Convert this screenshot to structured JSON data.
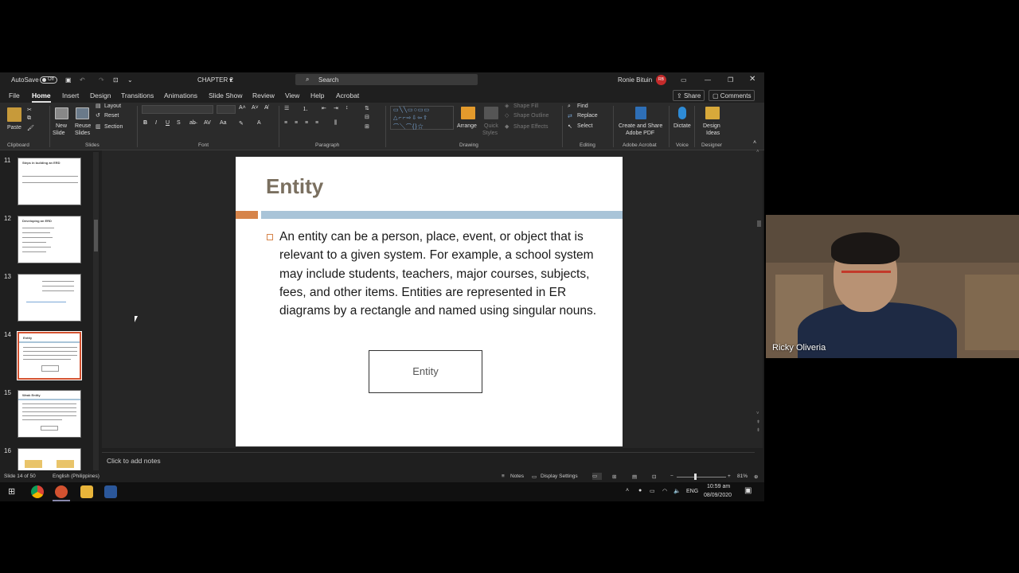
{
  "titlebar": {
    "autosave_label": "AutoSave",
    "autosave_state": "Off",
    "doc_title": "CHAPTER 2",
    "search_placeholder": "Search",
    "user_name": "Ronie Bituin",
    "user_initials": "RB"
  },
  "menu": {
    "tabs": [
      "File",
      "Home",
      "Insert",
      "Design",
      "Transitions",
      "Animations",
      "Slide Show",
      "Review",
      "View",
      "Help",
      "Acrobat"
    ],
    "share_label": "Share",
    "comments_label": "Comments"
  },
  "ribbon": {
    "clipboard": {
      "paste": "Paste",
      "group": "Clipboard"
    },
    "slides": {
      "new_slide_1": "New",
      "new_slide_2": "Slide",
      "reuse_1": "Reuse",
      "reuse_2": "Slides",
      "layout": "Layout",
      "reset": "Reset",
      "section": "Section",
      "group": "Slides"
    },
    "font": {
      "bold": "B",
      "italic": "I",
      "underline": "U",
      "strike": "S",
      "group": "Font"
    },
    "paragraph": {
      "group": "Paragraph"
    },
    "drawing": {
      "arrange": "Arrange",
      "quick_1": "Quick",
      "quick_2": "Styles",
      "shape_fill": "Shape Fill",
      "shape_outline": "Shape Outline",
      "shape_effects": "Shape Effects",
      "group": "Drawing"
    },
    "editing": {
      "find": "Find",
      "replace": "Replace",
      "select": "Select",
      "group": "Editing"
    },
    "acrobat": {
      "line1": "Create and Share",
      "line2": "Adobe PDF",
      "group": "Adobe Acrobat"
    },
    "voice": {
      "dictate": "Dictate",
      "group": "Voice"
    },
    "designer": {
      "line1": "Design",
      "line2": "Ideas",
      "group": "Designer"
    }
  },
  "thumbnails": [
    {
      "number": "11",
      "title": "Steps in building an ERD"
    },
    {
      "number": "12",
      "title": "Developing an ERD"
    },
    {
      "number": "13",
      "title": ""
    },
    {
      "number": "14",
      "title": "Entity"
    },
    {
      "number": "15",
      "title": "Weak Entity"
    },
    {
      "number": "16",
      "title": ""
    }
  ],
  "slide": {
    "title": "Entity",
    "body": "An entity can be a person, place, event, or object that is relevant to a given system. For example, a school system may include students, teachers, major courses, subjects, fees, and other items. Entities are represented in ER diagrams by a rectangle and named using singular nouns.",
    "shape_label": "Entity"
  },
  "notes_placeholder": "Click to add notes",
  "status": {
    "slide_counter": "Slide 14 of 50",
    "language": "English (Philippines)",
    "notes": "Notes",
    "display_settings": "Display Settings",
    "zoom": "81%"
  },
  "taskbar": {
    "language": "ENG",
    "time": "10:59 am",
    "date": "08/09/2020"
  },
  "video": {
    "participant_name": "Ricky Oliveria"
  },
  "colors": {
    "accent_orange": "#d6844a",
    "accent_blue": "#a9c4d8",
    "title_brown": "#7a6f5f",
    "selected_thumb": "#d35230"
  }
}
